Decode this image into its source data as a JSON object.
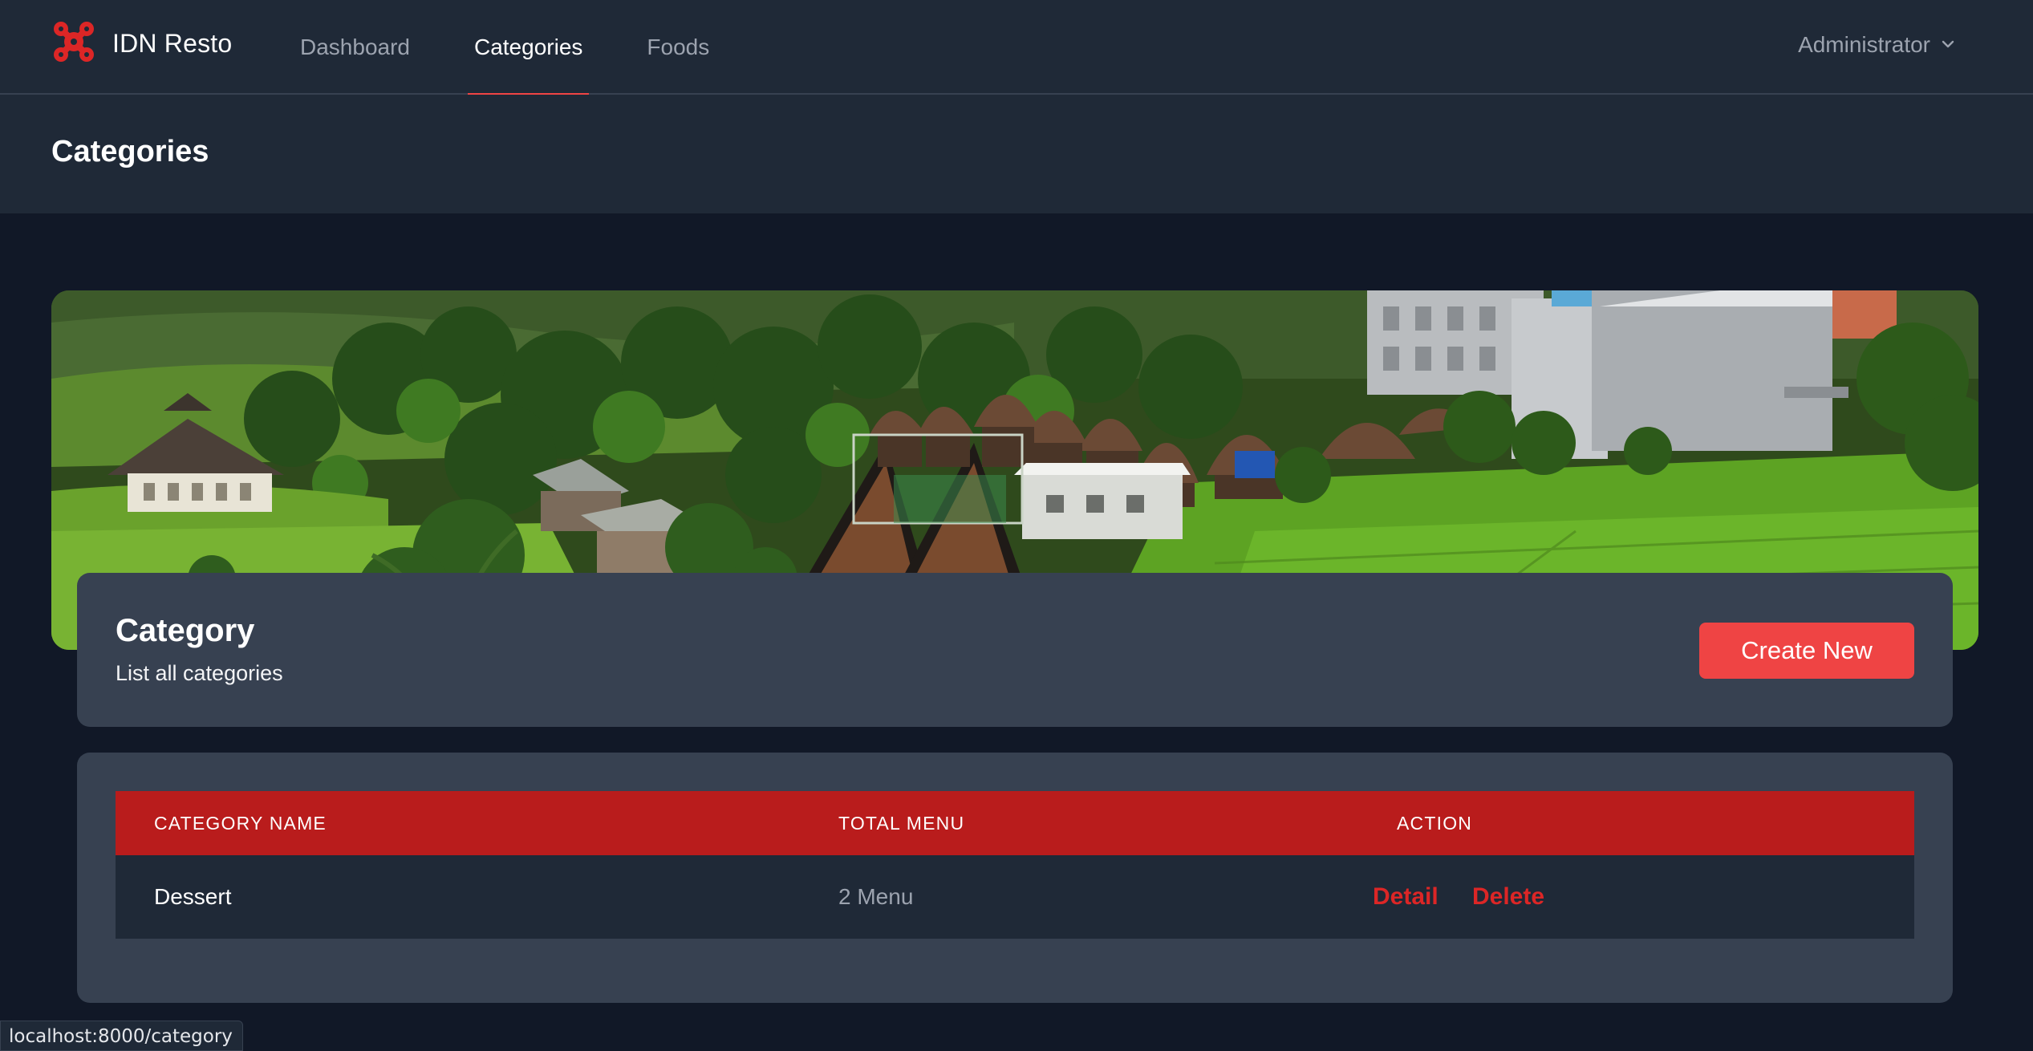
{
  "brand": {
    "name": "IDN Resto",
    "accent": "#dc2626"
  },
  "nav": {
    "items": [
      {
        "label": "Dashboard",
        "active": false
      },
      {
        "label": "Categories",
        "active": true
      },
      {
        "label": "Foods",
        "active": false
      }
    ]
  },
  "user": {
    "name": "Administrator"
  },
  "page": {
    "title": "Categories"
  },
  "card": {
    "title": "Category",
    "subtitle": "List all categories",
    "create_label": "Create New"
  },
  "table": {
    "headers": [
      "CATEGORY NAME",
      "TOTAL MENU",
      "ACTION"
    ],
    "rows": [
      {
        "name": "Dessert",
        "total": "2 Menu",
        "detail": "Detail",
        "delete": "Delete"
      }
    ]
  },
  "status": {
    "url": "localhost:8000/category"
  },
  "colors": {
    "header_bg": "#1f2937",
    "page_bg": "#111827",
    "card_bg": "#374151",
    "table_head_bg": "#b91c1c",
    "button": "#ef4444"
  },
  "icons": {
    "logo": "resto-logo-icon",
    "dropdown": "chevron-down-icon"
  }
}
